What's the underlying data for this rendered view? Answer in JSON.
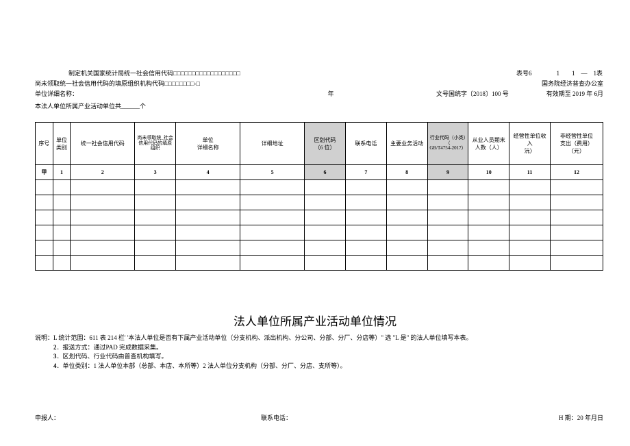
{
  "header": {
    "issuing_authority": "制定机关国家统计局统一社会信用代码□□□□□□□□□□□□□□□□□□",
    "form_no_label": "表号6",
    "form_no_suffix": "1　　1　—　1表",
    "fallback_code": "尚未领取统一社会信用代码的填原组织机构代码□□□□□□□□-□",
    "supervisor": "国务院经济普查办公室",
    "unit_name_label": "单位详细名称：",
    "year_char": "年",
    "doc_no": "文号国统字〔2018〕100 号",
    "valid_until": "有效期至 2019 年 6月",
    "sub_units_line": "本法人单位所属产业活动单位共______个"
  },
  "columns": {
    "seq": "序号",
    "category": "单位类别",
    "uscc": "统一社会信用代码",
    "fallback": "尚未领取统_社会信用代码的填原组织",
    "name": "单位\n详细名称",
    "address": "详细地址",
    "region": "区划代码\n（6 位）",
    "phone": "联系电话",
    "business": "主要业务活动",
    "industry": "行业代码（小类）（\nGB/T4754-2017）",
    "staff": "从业人员期末人数（人）",
    "income": "经营性单位收入\n沅〉",
    "expense": "非经营性单位\n支出（费用）\n（元）"
  },
  "row_ids": {
    "a": "甲",
    "c1": "1",
    "c2": "2",
    "c3": "3",
    "c4": "4",
    "c5": "5",
    "c6": "6",
    "c7": "7",
    "c8": "8",
    "c9": "9",
    "c10": "10",
    "c11": "11",
    "c12": "12"
  },
  "title": "法人单位所属产业活动单位情况",
  "notes": {
    "prefix": "说明：",
    "n1": "L 统计范围：611 表 214 栏' '本法人单位是否有下属产业活动单位（分支机构、派出机构、分公司、分部、分厂、分店等）\" 选 \"L 是\" 的法人单位填写本表。",
    "n2a": "2",
    "n2b": "．报送方式：通过PAD 完成数据采集。",
    "n3a": "3",
    "n3b": "．区划代码、行业代码由普查机构填写。",
    "n4a": "4",
    "n4b": "．单位类别：1 法人单位本部（总部、本店、本所等）2 法人单位分支机构（分部、分厂、分店、支所等）。"
  },
  "footer": {
    "reporter": "申报人：",
    "phone": "联系电话：",
    "date": "H 期：20 年月日"
  }
}
